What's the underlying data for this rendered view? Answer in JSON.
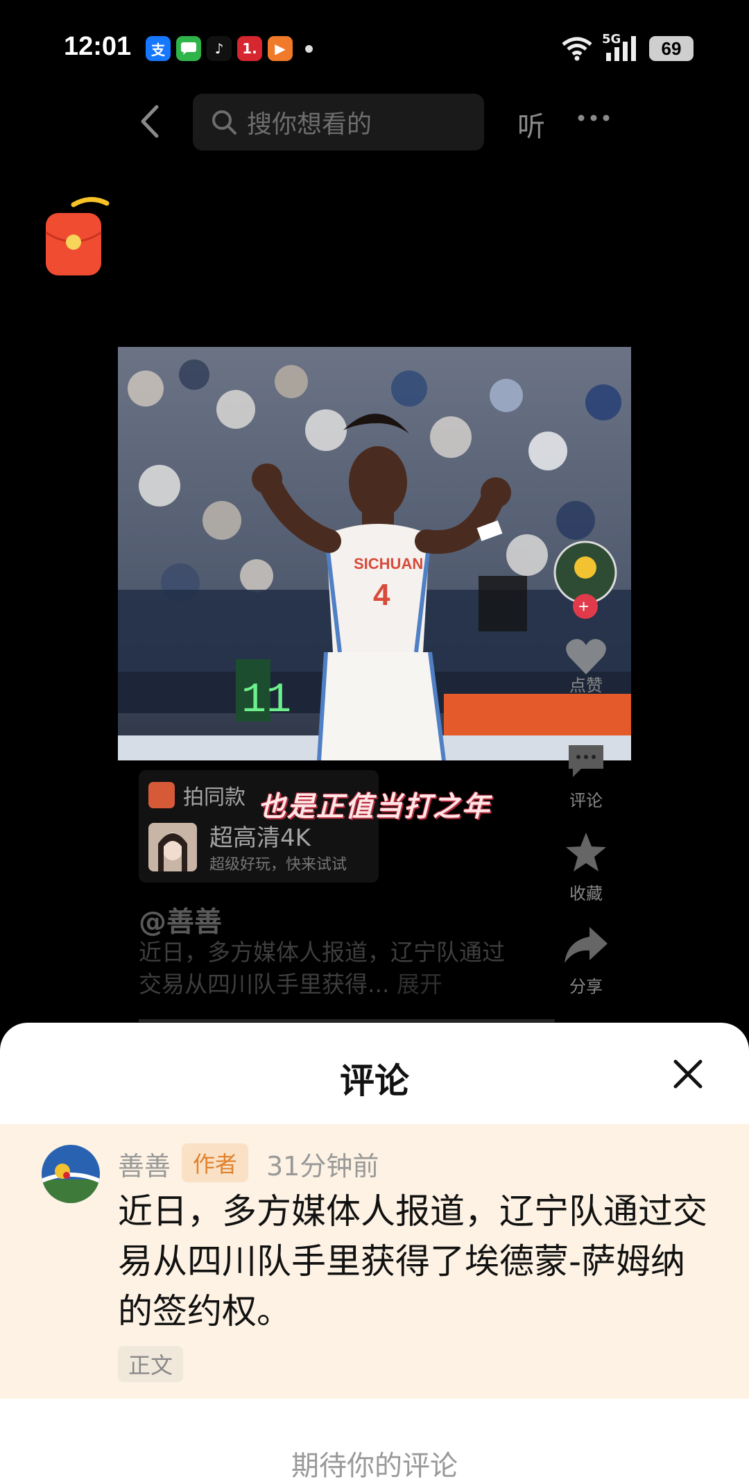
{
  "status_bar": {
    "time": "12:01",
    "apps": [
      {
        "name": "alipay-icon",
        "glyph": "支",
        "color": "#1677ff"
      },
      {
        "name": "messages-icon",
        "glyph": "",
        "color": "#2fb44a"
      },
      {
        "name": "tiktok-icon",
        "glyph": "♪",
        "color": "#111111"
      },
      {
        "name": "news-icon",
        "glyph": "1.",
        "color": "#d6262f"
      },
      {
        "name": "video-app-icon",
        "glyph": "▶",
        "color": "#f07a2a"
      }
    ],
    "network": "5G",
    "battery": "69"
  },
  "top_nav": {
    "search_placeholder": "搜你想看的",
    "listen_label": "听"
  },
  "video": {
    "jersey_team": "SICHUAN",
    "jersey_number": "4",
    "caption": "也是正值当打之年"
  },
  "side_actions": [
    {
      "name": "like",
      "label": "点赞"
    },
    {
      "name": "comment",
      "label": "评论"
    },
    {
      "name": "favorite",
      "label": "收藏"
    },
    {
      "name": "share",
      "label": "分享"
    }
  ],
  "paste_card": {
    "head": "拍同款",
    "title": "超高清4K",
    "subtitle": "超级好玩，快来试试"
  },
  "post": {
    "author": "@善善",
    "description": "近日，多方媒体人报道，辽宁队通过交易从四川队手里获得...",
    "expand_label": "展开"
  },
  "comment_sheet": {
    "title": "评论",
    "comment": {
      "user": "善善",
      "badge": "作者",
      "time": "31分钟前",
      "text": "近日，多方媒体人报道，辽宁队通过交易从四川队手里获得了埃德蒙-萨姆纳的签约权。",
      "tag": "正文"
    },
    "compose_placeholder": "期待你的评论"
  },
  "colors": {
    "sheet_bg": "#ffffff",
    "comment_bg": "#fdf2e3",
    "badge_text": "#e0812c"
  }
}
